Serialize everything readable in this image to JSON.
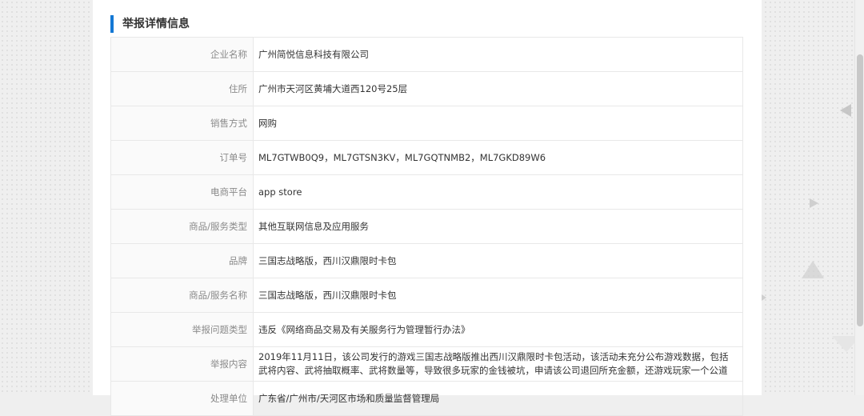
{
  "section": {
    "title": "举报详情信息"
  },
  "rows": [
    {
      "label": "企业名称",
      "value": "广州简悦信息科技有限公司"
    },
    {
      "label": "住所",
      "value": "广州市天河区黄埔大道西120号25层"
    },
    {
      "label": "销售方式",
      "value": "网购"
    },
    {
      "label": "订单号",
      "value": "ML7GTWB0Q9，ML7GTSN3KV，ML7GQTNMB2，ML7GKD89W6"
    },
    {
      "label": "电商平台",
      "value": "app store"
    },
    {
      "label": "商品/服务类型",
      "value": "其他互联网信息及应用服务"
    },
    {
      "label": "品牌",
      "value": "三国志战略版，西川汉鼎限时卡包"
    },
    {
      "label": "商品/服务名称",
      "value": "三国志战略版，西川汉鼎限时卡包"
    },
    {
      "label": "举报问题类型",
      "value": "违反《网络商品交易及有关服务行为管理暂行办法》"
    },
    {
      "label": "举报内容",
      "value": "2019年11月11日，该公司发行的游戏三国志战略版推出西川汉鼎限时卡包活动，该活动未充分公布游戏数据，包括武将内容、武将抽取概率、武将数量等，导致很多玩家的金钱被坑，申请该公司退回所充金额，还游戏玩家一个公道"
    },
    {
      "label": "处理单位",
      "value": "广东省/广州市/天河区市场和质量监督管理局"
    }
  ],
  "colors": {
    "accent": "#1478d4",
    "label_text": "#8a8a8a",
    "border": "#e8e8e8"
  }
}
